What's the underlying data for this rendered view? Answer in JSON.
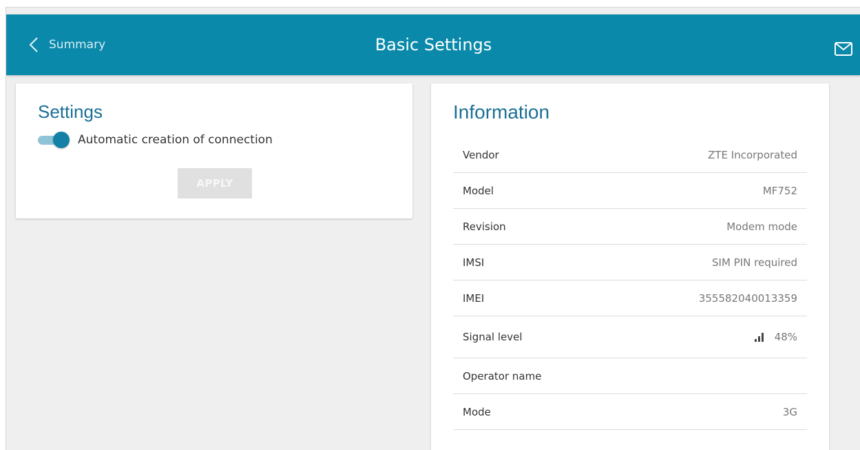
{
  "header": {
    "back_label": "Summary",
    "title": "Basic Settings"
  },
  "settings": {
    "title": "Settings",
    "toggle_label": "Automatic creation of connection",
    "toggle_on": true,
    "apply_label": "APPLY"
  },
  "info": {
    "title": "Information",
    "rows": [
      {
        "key": "Vendor",
        "value": "ZTE Incorporated"
      },
      {
        "key": "Model",
        "value": "MF752"
      },
      {
        "key": "Revision",
        "value": "Modem mode"
      },
      {
        "key": "IMSI",
        "value": "SIM PIN required"
      },
      {
        "key": "IMEI",
        "value": "355582040013359"
      },
      {
        "key": "Signal level",
        "value": "48%"
      },
      {
        "key": "Operator name",
        "value": ""
      },
      {
        "key": "Mode",
        "value": "3G"
      }
    ]
  },
  "colors": {
    "header_bg": "#0a89aa",
    "accent": "#1381a6",
    "heading": "#1b6f96"
  },
  "icons": {
    "back": "chevron-left-icon",
    "mail": "mail-icon",
    "signal": "signal-bars-icon"
  }
}
